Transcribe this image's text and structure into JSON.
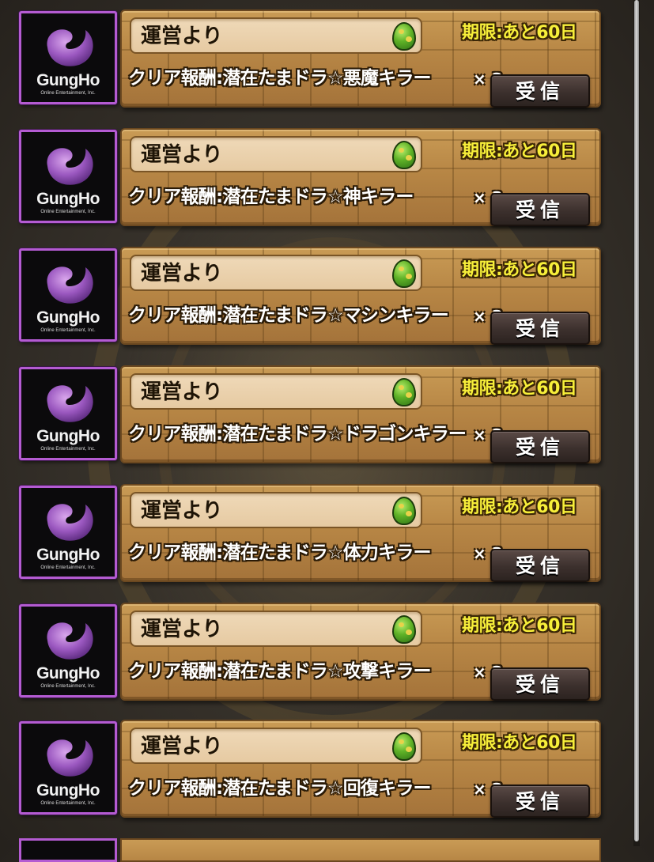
{
  "mail": {
    "items": [
      {
        "logo": "GungHo",
        "logo_sub": "Online Entertainment, Inc.",
        "sender": "運営より",
        "deadline": "期限:あと60日",
        "reward": "クリア報酬:潜在たまドラ☆悪魔キラー",
        "quantity": "× 3",
        "button": "受信"
      },
      {
        "logo": "GungHo",
        "logo_sub": "Online Entertainment, Inc.",
        "sender": "運営より",
        "deadline": "期限:あと60日",
        "reward": "クリア報酬:潜在たまドラ☆神キラー",
        "quantity": "× 3",
        "button": "受信"
      },
      {
        "logo": "GungHo",
        "logo_sub": "Online Entertainment, Inc.",
        "sender": "運営より",
        "deadline": "期限:あと60日",
        "reward": "クリア報酬:潜在たまドラ☆マシンキラー",
        "quantity": "× 3",
        "button": "受信"
      },
      {
        "logo": "GungHo",
        "logo_sub": "Online Entertainment, Inc.",
        "sender": "運営より",
        "deadline": "期限:あと60日",
        "reward": "クリア報酬:潜在たまドラ☆ドラゴンキラー",
        "quantity": "× 3",
        "button": "受信"
      },
      {
        "logo": "GungHo",
        "logo_sub": "Online Entertainment, Inc.",
        "sender": "運営より",
        "deadline": "期限:あと60日",
        "reward": "クリア報酬:潜在たまドラ☆体力キラー",
        "quantity": "× 3",
        "button": "受信"
      },
      {
        "logo": "GungHo",
        "logo_sub": "Online Entertainment, Inc.",
        "sender": "運営より",
        "deadline": "期限:あと60日",
        "reward": "クリア報酬:潜在たまドラ☆攻撃キラー",
        "quantity": "× 3",
        "button": "受信"
      },
      {
        "logo": "GungHo",
        "logo_sub": "Online Entertainment, Inc.",
        "sender": "運営より",
        "deadline": "期限:あと60日",
        "reward": "クリア報酬:潜在たまドラ☆回復キラー",
        "quantity": "× 3",
        "button": "受信"
      }
    ]
  },
  "colors": {
    "icon_border": "#b45bd2",
    "deadline_text": "#f7ef3a",
    "panel": "#b78645",
    "button": "#3c302d"
  },
  "icons": {
    "sender_logo": "gungho-logo-icon",
    "item_type": "egg-icon"
  }
}
